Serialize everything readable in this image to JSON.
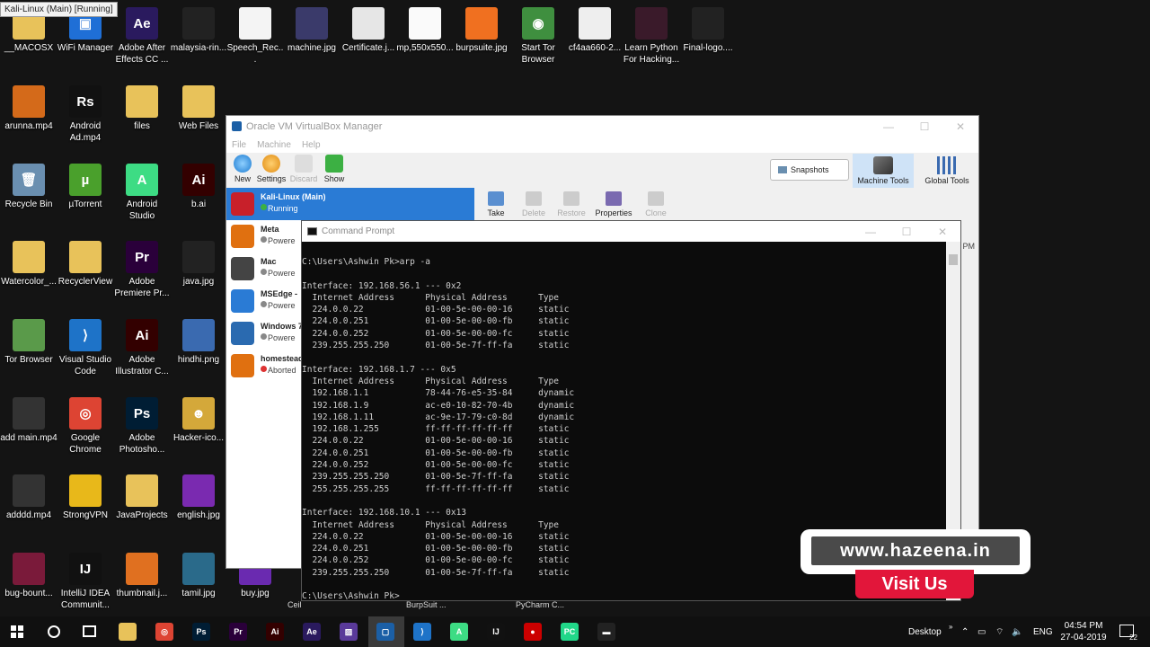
{
  "tooltip": "Kali-Linux (Main) [Running]",
  "desktop_icons": [
    {
      "label": "__MACOSX",
      "glyph": "",
      "color": "#e8c25a"
    },
    {
      "label": "WiFi Manager",
      "glyph": "▣",
      "color": "#1f6fd6"
    },
    {
      "label": "Adobe After Effects CC ...",
      "glyph": "Ae",
      "color": "#2a1a5e"
    },
    {
      "label": "malaysia-rin...",
      "glyph": "",
      "color": "#222"
    },
    {
      "label": "Speech_Rec...",
      "glyph": "",
      "color": "#f4f4f4"
    },
    {
      "label": "machine.jpg",
      "glyph": "",
      "color": "#3a3a6a"
    },
    {
      "label": "Certificate.j...",
      "glyph": "",
      "color": "#e6e6e6"
    },
    {
      "label": "mp,550x550...",
      "glyph": "",
      "color": "#fafafa"
    },
    {
      "label": "burpsuite.jpg",
      "glyph": "",
      "color": "#f07020"
    },
    {
      "label": "Start Tor Browser",
      "glyph": "◉",
      "color": "#3f8f3f"
    },
    {
      "label": "cf4aa660-2...",
      "glyph": "",
      "color": "#eee"
    },
    {
      "label": "Learn Python For Hacking...",
      "glyph": "",
      "color": "#3a1a2a"
    },
    {
      "label": "Final-logo....",
      "glyph": "",
      "color": "#222"
    },
    {
      "label": "arunna.mp4",
      "glyph": "",
      "color": "#d46a1a"
    },
    {
      "label": "Android Ad.mp4",
      "glyph": "Rs",
      "color": "#111"
    },
    {
      "label": "files",
      "glyph": "",
      "color": "#e8c25a"
    },
    {
      "label": "Web Files",
      "glyph": "",
      "color": "#e8c25a"
    },
    {
      "label": "Recycle Bin",
      "glyph": "🗑",
      "color": "#6a8fb0"
    },
    {
      "label": "µTorrent",
      "glyph": "µ",
      "color": "#4aa02c"
    },
    {
      "label": "Android Studio",
      "glyph": "A",
      "color": "#3ddc84"
    },
    {
      "label": "b.ai",
      "glyph": "Ai",
      "color": "#330000"
    },
    {
      "label": "Watercolor_...",
      "glyph": "",
      "color": "#e8c25a"
    },
    {
      "label": "RecyclerView",
      "glyph": "",
      "color": "#e8c25a"
    },
    {
      "label": "Adobe Premiere Pr...",
      "glyph": "Pr",
      "color": "#2a003a"
    },
    {
      "label": "java.jpg",
      "glyph": "",
      "color": "#222"
    },
    {
      "label": "Tor Browser",
      "glyph": "",
      "color": "#5a9a4a"
    },
    {
      "label": "Visual Studio Code",
      "glyph": "⟩",
      "color": "#1e73c8"
    },
    {
      "label": "Adobe Illustrator C...",
      "glyph": "Ai",
      "color": "#330000"
    },
    {
      "label": "hindhi.png",
      "glyph": "",
      "color": "#3a6ab0"
    },
    {
      "label": "add main.mp4",
      "glyph": "",
      "color": "#333"
    },
    {
      "label": "Google Chrome",
      "glyph": "◎",
      "color": "#dd4433"
    },
    {
      "label": "Adobe Photosho...",
      "glyph": "Ps",
      "color": "#001d34"
    },
    {
      "label": "Hacker-ico...",
      "glyph": "☻",
      "color": "#d4a83a"
    },
    {
      "label": "adddd.mp4",
      "glyph": "",
      "color": "#333"
    },
    {
      "label": "StrongVPN",
      "glyph": "",
      "color": "#e8b81a"
    },
    {
      "label": "JavaProjects",
      "glyph": "",
      "color": "#e8c25a"
    },
    {
      "label": "english.jpg",
      "glyph": "",
      "color": "#7a2ab0"
    },
    {
      "label": "bug-bount...",
      "glyph": "",
      "color": "#7a1a3a"
    },
    {
      "label": "IntelliJ IDEA Communit...",
      "glyph": "IJ",
      "color": "#111"
    },
    {
      "label": "thumbnail.j...",
      "glyph": "",
      "color": "#e07020"
    },
    {
      "label": "tamil.jpg",
      "glyph": "",
      "color": "#2a6a8a"
    },
    {
      "label": "buy.jpg",
      "glyph": "",
      "color": "#6a2ab0"
    }
  ],
  "vbox": {
    "title": "Oracle VM VirtualBox Manager",
    "menu": [
      "File",
      "Machine",
      "Help"
    ],
    "toolbar": [
      "New",
      "Settings",
      "Discard",
      "Show"
    ],
    "snapshots_label": "Snapshots",
    "machine_tools_label": "Machine Tools",
    "global_tools_label": "Global Tools",
    "vms": [
      {
        "name": "Kali-Linux",
        "suffix": "(Main)",
        "state": "Running",
        "color": "#c8202a"
      },
      {
        "name": "Meta",
        "suffix": "",
        "state": "Powere",
        "color": "#e07010"
      },
      {
        "name": "Mac",
        "suffix": "",
        "state": "Powere",
        "color": "#444"
      },
      {
        "name": "MSEdge - ",
        "suffix": "",
        "state": "Powere",
        "color": "#2a7bd5"
      },
      {
        "name": "Windows 7",
        "suffix": "",
        "state": "Powere",
        "color": "#2a6ab0"
      },
      {
        "name": "homestead",
        "suffix": "",
        "state": "Aborted",
        "color": "#e07010"
      }
    ],
    "snapshot_tools": [
      "Take",
      "Delete",
      "Restore",
      "Properties",
      "Clone"
    ],
    "pm_label": "PM",
    "ceil_label": "Ceil"
  },
  "cmd": {
    "title": "Command Prompt",
    "lines": [
      "C:\\Users\\Ashwin Pk>arp -a",
      "",
      "Interface: 192.168.56.1 --- 0x2",
      "  Internet Address      Physical Address      Type",
      "  224.0.0.22            01-00-5e-00-00-16     static",
      "  224.0.0.251           01-00-5e-00-00-fb     static",
      "  224.0.0.252           01-00-5e-00-00-fc     static",
      "  239.255.255.250       01-00-5e-7f-ff-fa     static",
      "",
      "Interface: 192.168.1.7 --- 0x5",
      "  Internet Address      Physical Address      Type",
      "  192.168.1.1           78-44-76-e5-35-84     dynamic",
      "  192.168.1.9           ac-e0-10-82-70-4b     dynamic",
      "  192.168.1.11          ac-9e-17-79-c0-8d     dynamic",
      "  192.168.1.255         ff-ff-ff-ff-ff-ff     static",
      "  224.0.0.22            01-00-5e-00-00-16     static",
      "  224.0.0.251           01-00-5e-00-00-fb     static",
      "  224.0.0.252           01-00-5e-00-00-fc     static",
      "  239.255.255.250       01-00-5e-7f-ff-fa     static",
      "  255.255.255.255       ff-ff-ff-ff-ff-ff     static",
      "",
      "Interface: 192.168.10.1 --- 0x13",
      "  Internet Address      Physical Address      Type",
      "  224.0.0.22            01-00-5e-00-00-16     static",
      "  224.0.0.251           01-00-5e-00-00-fb     static",
      "  224.0.0.252           01-00-5e-00-00-fc     static",
      "  239.255.255.250       01-00-5e-7f-ff-fa     static",
      "",
      "C:\\Users\\Ashwin Pk>"
    ]
  },
  "watermark": {
    "site": "www.hazeena.in",
    "cta": "Visit Us"
  },
  "taskbar": {
    "under_labels": [
      "BurpSuit ...",
      "PyCharm C..."
    ],
    "desktop_label": "Desktop",
    "lang": "ENG",
    "time": "04:54 PM",
    "date": "27-04-2019",
    "notif_count": "22",
    "apps": [
      {
        "glyph": "",
        "color": "#e8c25a",
        "name": "file-explorer-icon"
      },
      {
        "glyph": "◎",
        "color": "#dd4433",
        "name": "chrome-icon"
      },
      {
        "glyph": "Ps",
        "color": "#001d34",
        "name": "photoshop-icon"
      },
      {
        "glyph": "Pr",
        "color": "#2a003a",
        "name": "premiere-icon"
      },
      {
        "glyph": "Ai",
        "color": "#330000",
        "name": "illustrator-icon"
      },
      {
        "glyph": "Ae",
        "color": "#2a1a5e",
        "name": "after-effects-icon"
      },
      {
        "glyph": "▨",
        "color": "#5a3a9a",
        "name": "visual-studio-icon"
      },
      {
        "glyph": "▢",
        "color": "#1b5fa6",
        "name": "virtualbox-icon"
      },
      {
        "glyph": "⟩",
        "color": "#1e73c8",
        "name": "vscode-icon"
      },
      {
        "glyph": "A",
        "color": "#3ddc84",
        "name": "android-studio-icon"
      },
      {
        "glyph": "IJ",
        "color": "#111",
        "name": "intellij-icon"
      },
      {
        "glyph": "●",
        "color": "#c00",
        "name": "recorder-icon"
      },
      {
        "glyph": "PC",
        "color": "#21d789",
        "name": "pycharm-icon"
      },
      {
        "glyph": "▬",
        "color": "#222",
        "name": "cmd-icon"
      }
    ]
  }
}
